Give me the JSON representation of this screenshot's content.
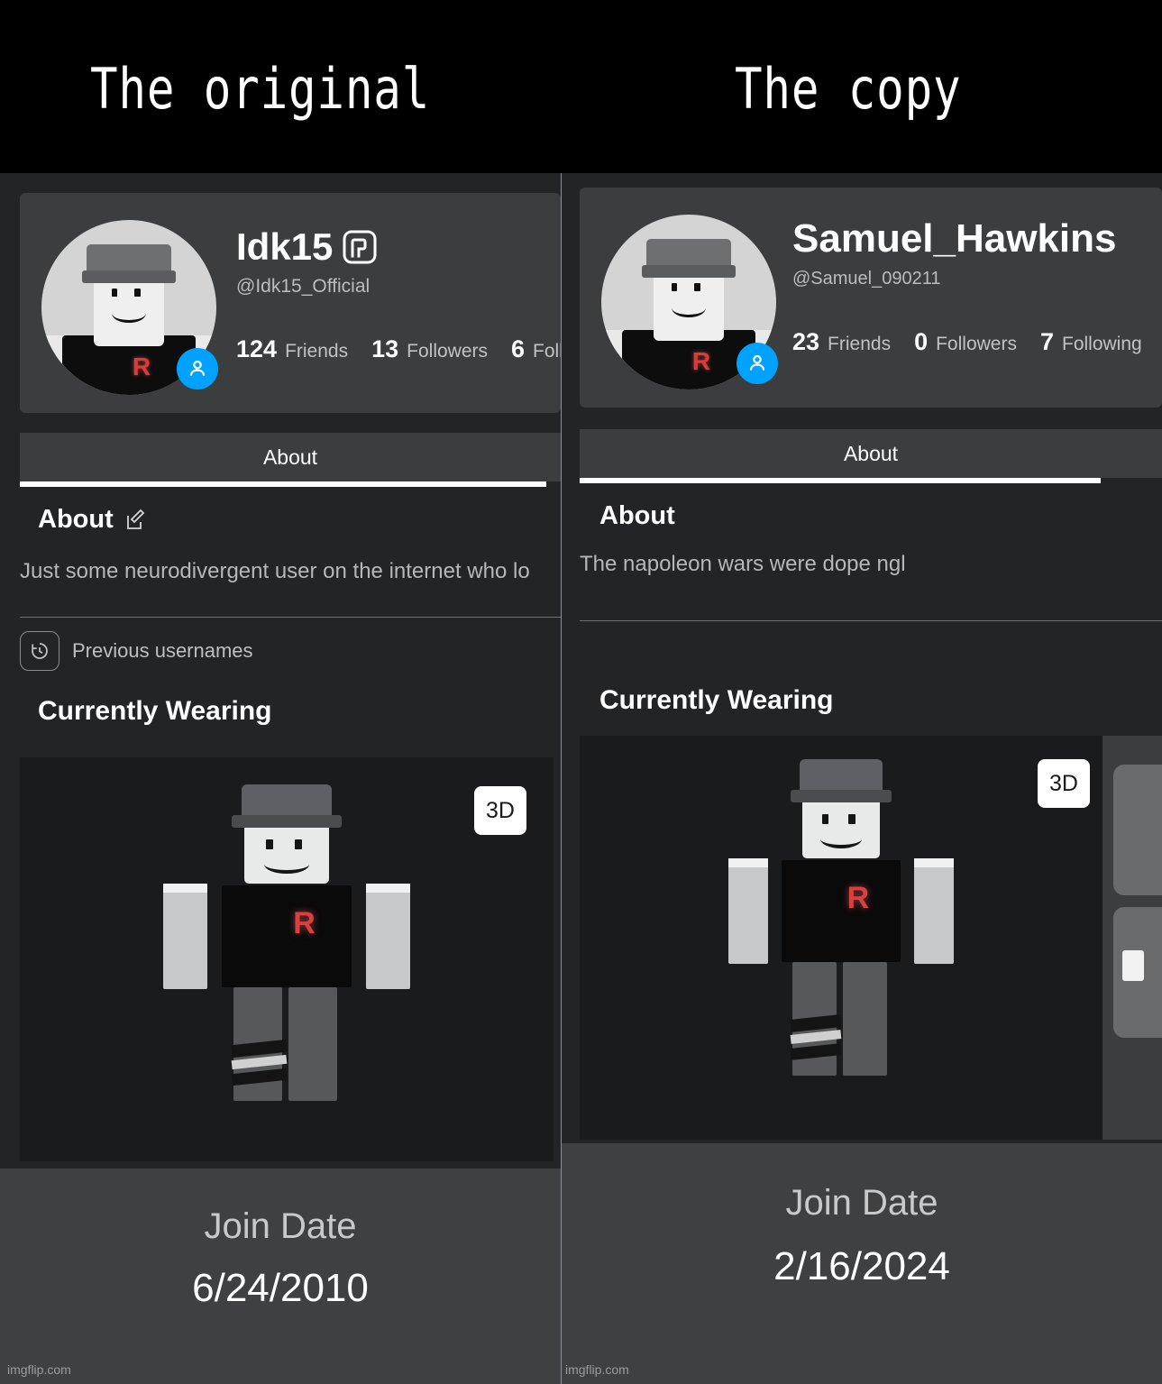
{
  "meme": {
    "caption_left": "The original",
    "caption_right": "The copy",
    "watermark": "imgflip.com"
  },
  "colors": {
    "background": "#000000",
    "panel_bg": "#232425",
    "card_bg": "#3c3d3f",
    "stage_bg": "#1a1b1c",
    "join_bg": "#3f4042",
    "accent_badge": "#00a2ff",
    "roblox_logo_red": "#d93b3b",
    "tab_underline": "#ffffff",
    "muted_text": "#b7b7b7"
  },
  "left_profile": {
    "display_name": "Idk15",
    "premium_badge_icon": "roblox-premium-icon",
    "handle": "@Idk15_Official",
    "friend_badge_icon": "person-badge-icon",
    "stats": [
      {
        "count": "124",
        "label": "Friends"
      },
      {
        "count": "13",
        "label": "Followers"
      },
      {
        "count": "6",
        "label": "Following"
      }
    ],
    "tab": "About",
    "about_heading": "About",
    "edit_icon": "edit-pencil-icon",
    "bio": "Just some neurodivergent user on the internet who lo",
    "previous_usernames": {
      "label": "Previous usernames",
      "icon": "history-clock-icon"
    },
    "currently_wearing_heading": "Currently Wearing",
    "view_3d_label": "3D",
    "join_date_label": "Join Date",
    "join_date_value": "6/24/2010"
  },
  "right_profile": {
    "display_name": "Samuel_Hawkins",
    "handle": "@Samuel_090211",
    "friend_badge_icon": "person-badge-icon",
    "stats": [
      {
        "count": "23",
        "label": "Friends"
      },
      {
        "count": "0",
        "label": "Followers"
      },
      {
        "count": "7",
        "label": "Following"
      }
    ],
    "tab": "About",
    "about_heading": "About",
    "bio": "The napoleon wars were dope ngl",
    "currently_wearing_heading": "Currently Wearing",
    "view_3d_label": "3D",
    "join_date_label": "Join Date",
    "join_date_value": "2/16/2024"
  }
}
